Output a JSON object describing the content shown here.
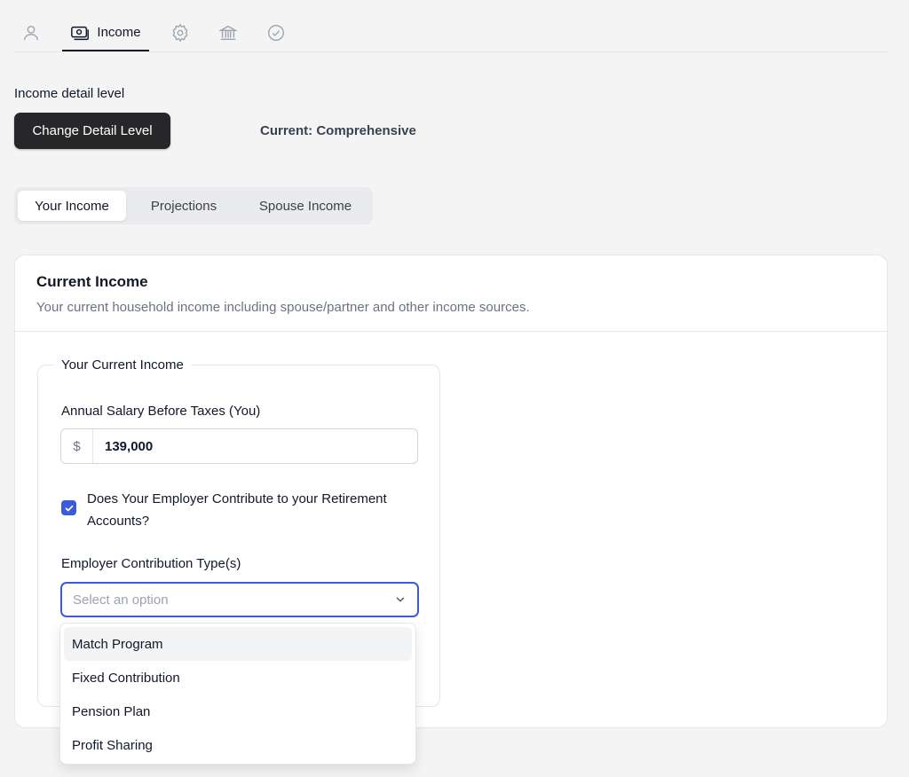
{
  "nav": {
    "tabs": [
      {
        "icon": "user-icon",
        "label": ""
      },
      {
        "icon": "money-icon",
        "label": "Income"
      },
      {
        "icon": "gear-icon",
        "label": ""
      },
      {
        "icon": "bank-icon",
        "label": ""
      },
      {
        "icon": "check-circle-icon",
        "label": ""
      }
    ],
    "active_index": 1
  },
  "detail": {
    "label": "Income detail level",
    "button": "Change Detail Level",
    "current": "Current: Comprehensive"
  },
  "tabs": {
    "items": [
      "Your Income",
      "Projections",
      "Spouse Income"
    ],
    "active_index": 0
  },
  "card": {
    "title": "Current Income",
    "description": "Your current household income including spouse/partner and other income sources."
  },
  "fieldset": {
    "legend": "Your Current Income",
    "salary_label": "Annual Salary Before Taxes (You)",
    "currency_prefix": "$",
    "salary_value": "139,000",
    "employer_contrib_label": "Does Your Employer Contribute to your Retirement Accounts?",
    "employer_contrib_checked": true,
    "contrib_type_label": "Employer Contribution Type(s)",
    "contrib_type_placeholder": "Select an option"
  },
  "dropdown": {
    "options": [
      "Match Program",
      "Fixed Contribution",
      "Pension Plan",
      "Profit Sharing"
    ],
    "highlighted_index": 0
  },
  "colors": {
    "accent": "#3b5bdb",
    "dark_button": "#27272a"
  }
}
